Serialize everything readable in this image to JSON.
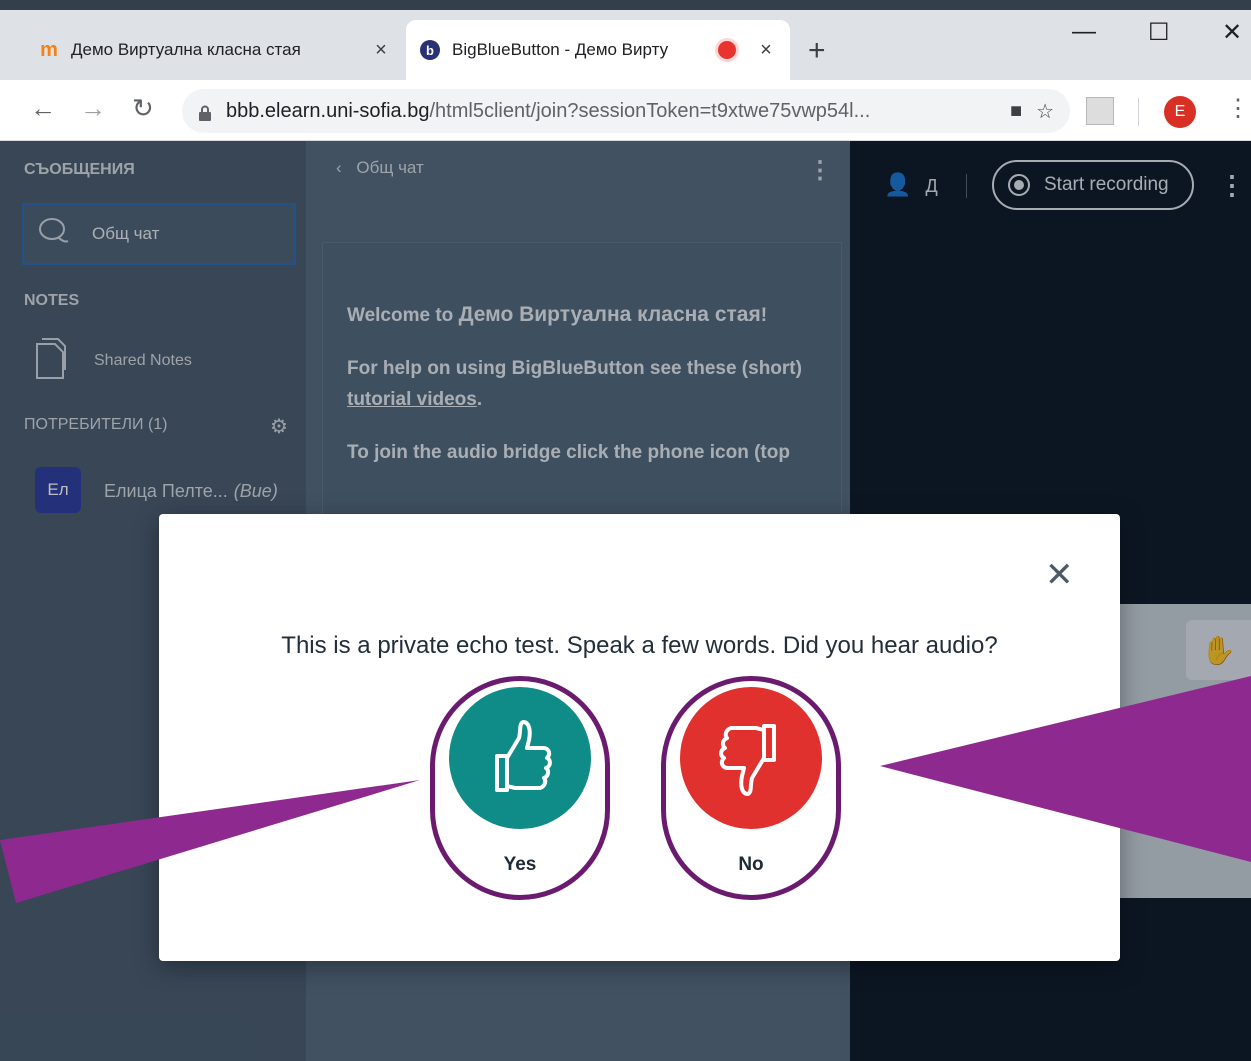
{
  "browser": {
    "tabs": [
      {
        "title": "Демо Виртуална класна стая",
        "favicon": "moodle-icon",
        "close": "×"
      },
      {
        "title": "BigBlueButton - Демо Вирту",
        "favicon": "bigbluebutton-icon",
        "close": "×",
        "active": true
      }
    ],
    "new_tab": "+",
    "window_controls": {
      "minimize": "—",
      "maximize": "☐",
      "close": "✕"
    },
    "url_host": "bbb.elearn.uni-sofia.bg",
    "url_path": "/html5client/join?sessionToken=t9xtwe75vwp54l...",
    "profile_initial": "E"
  },
  "sidebar": {
    "messages_heading": "СЪОБЩЕНИЯ",
    "public_chat_label": "Общ чат",
    "notes_heading": "NOTES",
    "shared_notes_label": "Shared Notes",
    "users_heading": "ПОТРЕБИТЕЛИ (1)",
    "user": {
      "initials": "Ел",
      "name": "Елица Пелте...",
      "suffix": "(Вие)"
    }
  },
  "chat": {
    "header": "Общ чат",
    "welcome_prefix": "Welcome to ",
    "room_name": "Демо Виртуална класна стая",
    "welcome_suffix": "!",
    "help_text": "For help on using BigBlueButton see these (short) ",
    "help_link": "tutorial videos",
    "help_end": ".",
    "audio_text": "To join the audio bridge click the phone icon (top"
  },
  "presentation": {
    "user_initial": "Д",
    "record_label": "Start recording"
  },
  "dialog": {
    "question": "This is a private echo test. Speak a few words. Did you hear audio?",
    "yes_label": "Yes",
    "no_label": "No"
  },
  "colors": {
    "yes": "#0f8c87",
    "no": "#e0312f",
    "annotation": "#8e2a8f",
    "ring": "#6a1b6f"
  }
}
